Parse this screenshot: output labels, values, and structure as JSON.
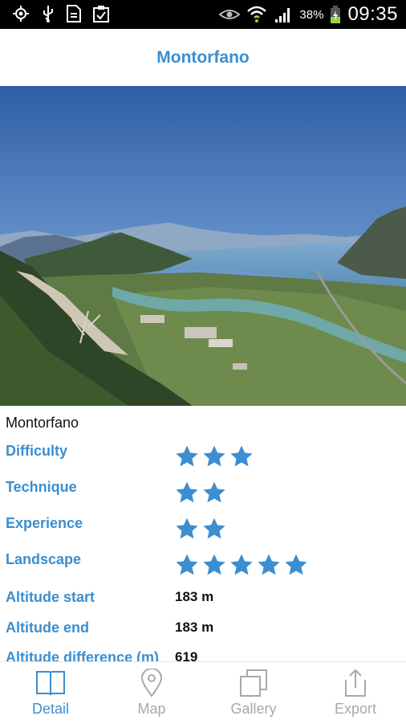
{
  "status_bar": {
    "battery_percent": "38%",
    "time": "09:35"
  },
  "header": {
    "title": "Montorfano"
  },
  "detail": {
    "name": "Montorfano",
    "ratings": [
      {
        "label": "Difficulty",
        "stars": 3
      },
      {
        "label": "Technique",
        "stars": 2
      },
      {
        "label": "Experience",
        "stars": 2
      },
      {
        "label": "Landscape",
        "stars": 5
      }
    ],
    "altitude_start": {
      "label": "Altitude start",
      "value": "183 m"
    },
    "altitude_end": {
      "label": "Altitude end",
      "value": "183 m"
    },
    "altitude_difference": {
      "label": "Altitude difference (m)",
      "value": "619"
    }
  },
  "tabs": [
    {
      "label": "Detail",
      "icon": "book-icon",
      "active": true
    },
    {
      "label": "Map",
      "icon": "map-pin-icon",
      "active": false
    },
    {
      "label": "Gallery",
      "icon": "gallery-icon",
      "active": false
    },
    {
      "label": "Export",
      "icon": "share-icon",
      "active": false
    }
  ],
  "colors": {
    "accent": "#3b8ed0",
    "inactive": "#a9a9a9",
    "star": "#3b8ed0"
  }
}
